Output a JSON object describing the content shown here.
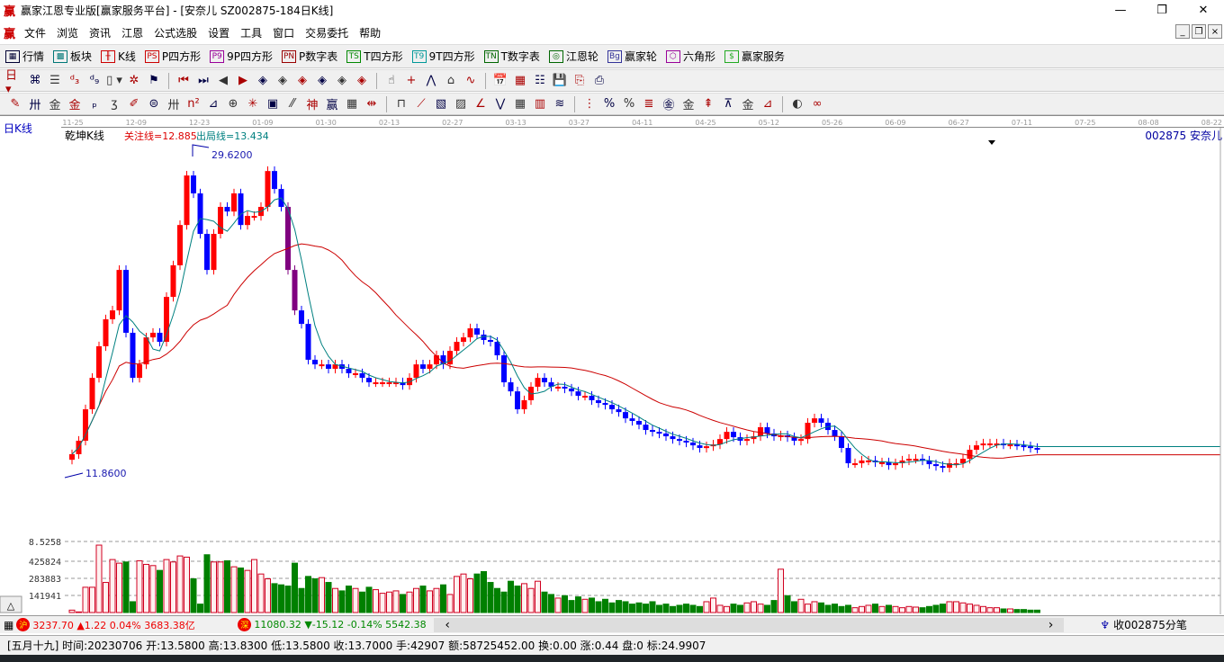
{
  "window": {
    "title": "赢家江恩专业版[赢家服务平台] - [安奈儿  SZ002875-184日K线]",
    "logo": "赢",
    "minimize": "—",
    "restore": "❐",
    "close": "✕"
  },
  "menu": [
    "文件",
    "浏览",
    "资讯",
    "江恩",
    "公式选股",
    "设置",
    "工具",
    "窗口",
    "交易委托",
    "帮助"
  ],
  "toolbar1": [
    {
      "label": "行情",
      "icon": "▦",
      "color": "#003"
    },
    {
      "label": "板块",
      "icon": "▩",
      "color": "#077"
    },
    {
      "label": "K线",
      "icon": "╫",
      "color": "#c00"
    },
    {
      "label": "P四方形",
      "icon": "PS",
      "color": "#c00"
    },
    {
      "label": "9P四方形",
      "icon": "P9",
      "color": "#909"
    },
    {
      "label": "P数字表",
      "icon": "PN",
      "color": "#900"
    },
    {
      "label": "T四方形",
      "icon": "TS",
      "color": "#080"
    },
    {
      "label": "9T四方形",
      "icon": "T9",
      "color": "#099"
    },
    {
      "label": "T数字表",
      "icon": "TN",
      "color": "#060"
    },
    {
      "label": "江恩轮",
      "icon": "◎",
      "color": "#060"
    },
    {
      "label": "赢家轮",
      "icon": "Bg",
      "color": "#339"
    },
    {
      "label": "六角形",
      "icon": "⬡",
      "color": "#909"
    },
    {
      "label": "赢家服务",
      "icon": "$",
      "color": "#2a2"
    }
  ],
  "toolbar2": [
    "日 ▾",
    "⌘",
    "☰",
    "ᵈ₃",
    "ᵈ₉",
    "▯ ▾",
    "✲",
    "⚑",
    "|",
    "⏮",
    "⏭",
    "◀",
    "▶",
    "◈",
    "◈",
    "◈",
    "◈",
    "◈",
    "◈",
    "|",
    "☝",
    "+",
    "⋀",
    "⌂",
    "∿",
    "|",
    "📅",
    "▦",
    "☷",
    "💾",
    "⎘",
    "⎙"
  ],
  "toolbar3": [
    "✎",
    "卅",
    "金",
    "金",
    "ₚ",
    "ʒ",
    "✐",
    "⊜",
    "卅",
    "n²",
    "⊿",
    "⊕",
    "✳",
    "▣",
    "⁄⁄",
    "神",
    "赢",
    "▦",
    "⇹",
    "|",
    "⊓",
    "⟋",
    "▧",
    "▨",
    "∠",
    "⋁",
    "▦",
    "▥",
    "≋",
    "|",
    "⋮",
    "%",
    "%",
    "≣",
    "㊎",
    "金",
    "⇞",
    "⊼",
    "金",
    "⊿",
    "|",
    "◐",
    "∞"
  ],
  "chart": {
    "period_label": "日K线",
    "indicator": "乾坤K线",
    "attention": "关注线=12.885",
    "exit": "出局线=13.434",
    "stock": "002875  安奈儿",
    "max_label": "29.6200",
    "min_label": "11.8600",
    "dates": [
      "11-25",
      "12-09",
      "12-23",
      "01-09",
      "01-30",
      "02-13",
      "02-27",
      "03-13",
      "03-27",
      "04-11",
      "04-25",
      "05-12",
      "05-26",
      "06-09",
      "06-27",
      "07-11",
      "07-25",
      "08-08",
      "08-22"
    ],
    "vol_ticks": [
      "8.5258",
      "425824",
      "283883",
      "141941"
    ],
    "colors": {
      "up": "#ff0000",
      "down": "#0000ff",
      "purple": "#800080",
      "ma_fast": "#008080",
      "ma_slow": "#cc0000",
      "vol_down": "#008000"
    }
  },
  "chart_data": {
    "type": "candlestick",
    "title": "SZ002875 安奈儿 日K线",
    "price_range": [
      11.86,
      29.62
    ],
    "closes": [
      12.93,
      13.66,
      15.36,
      17.06,
      18.77,
      20.23,
      20.71,
      22.9,
      19.5,
      17.06,
      17.79,
      19.25,
      19.5,
      19.01,
      21.44,
      23.15,
      25.33,
      28.01,
      27.04,
      24.85,
      22.9,
      24.85,
      26.31,
      26.06,
      27.04,
      25.33,
      25.82,
      25.82,
      26.31,
      28.25,
      27.28,
      26.31,
      22.9,
      20.71,
      19.98,
      18.04,
      17.79,
      17.79,
      17.55,
      17.79,
      17.55,
      17.31,
      17.31,
      17.06,
      16.82,
      16.82,
      16.82,
      16.82,
      16.82,
      16.67,
      17.06,
      17.79,
      17.55,
      17.79,
      18.28,
      17.79,
      18.52,
      19.01,
      19.25,
      19.74,
      19.4,
      19.11,
      19.01,
      18.28,
      16.82,
      16.33,
      15.36,
      15.85,
      16.58,
      17.06,
      16.82,
      16.58,
      16.58,
      16.48,
      16.33,
      16.09,
      16.09,
      15.85,
      15.7,
      15.6,
      15.36,
      15.21,
      14.87,
      14.73,
      14.53,
      14.24,
      14.14,
      14.05,
      13.9,
      13.75,
      13.66,
      13.56,
      13.41,
      13.27,
      13.36,
      13.46,
      13.75,
      14.14,
      13.85,
      13.66,
      13.75,
      13.9,
      14.39,
      14.05,
      13.9,
      13.95,
      13.85,
      13.66,
      13.75,
      14.63,
      14.87,
      14.63,
      14.24,
      13.9,
      13.27,
      12.44,
      12.44,
      12.59,
      12.59,
      12.49,
      12.49,
      12.34,
      12.44,
      12.59,
      12.68,
      12.68,
      12.59,
      12.39,
      12.29,
      12.2,
      12.44,
      12.44,
      12.68,
      13.17,
      13.41,
      13.51,
      13.51,
      13.51,
      13.46,
      13.46,
      13.41,
      13.36,
      13.27,
      13.22
    ],
    "volume_k": [
      20,
      5,
      210,
      210,
      560,
      250,
      440,
      410,
      420,
      90,
      430,
      400,
      390,
      350,
      440,
      420,
      470,
      460,
      280,
      70,
      480,
      420,
      420,
      430,
      380,
      370,
      350,
      440,
      320,
      280,
      240,
      230,
      220,
      410,
      200,
      300,
      280,
      290,
      250,
      200,
      180,
      220,
      200,
      170,
      210,
      190,
      160,
      170,
      180,
      150,
      170,
      200,
      220,
      180,
      200,
      230,
      150,
      300,
      320,
      280,
      320,
      340,
      250,
      200,
      170,
      260,
      220,
      240,
      200,
      260,
      170,
      150,
      120,
      140,
      100,
      130,
      110,
      120,
      90,
      110,
      80,
      100,
      90,
      70,
      80,
      70,
      90,
      60,
      70,
      50,
      60,
      70,
      60,
      50,
      90,
      120,
      60,
      50,
      70,
      60,
      80,
      90,
      70,
      60,
      100,
      360,
      140,
      90,
      110,
      70,
      90,
      80,
      60,
      70,
      50,
      60,
      40,
      50,
      60,
      70,
      50,
      60,
      50,
      40,
      50,
      45,
      40,
      50,
      60,
      70,
      90,
      90,
      80,
      70,
      60,
      50,
      40,
      40,
      30,
      30,
      25,
      25,
      20
    ],
    "volume_ticks": [
      141941,
      283883,
      425824
    ]
  },
  "index_bar": {
    "sh_badge": "沪",
    "sh": "3237.70 ▲1.22 0.04% 3683.38亿",
    "sz_badge": "深",
    "sz": "11080.32 ▼-15.12 -0.14% 5542.38",
    "left": "‹",
    "right": "›",
    "feed": "收002875分笔"
  },
  "status": "[五月十九] 时间:20230706 开:13.5800 高:13.8300 低:13.5800 收:13.7000 手:42907 额:58725452.00 换:0.00 涨:0.44 盘:0 标:24.9907",
  "collapse": "△"
}
